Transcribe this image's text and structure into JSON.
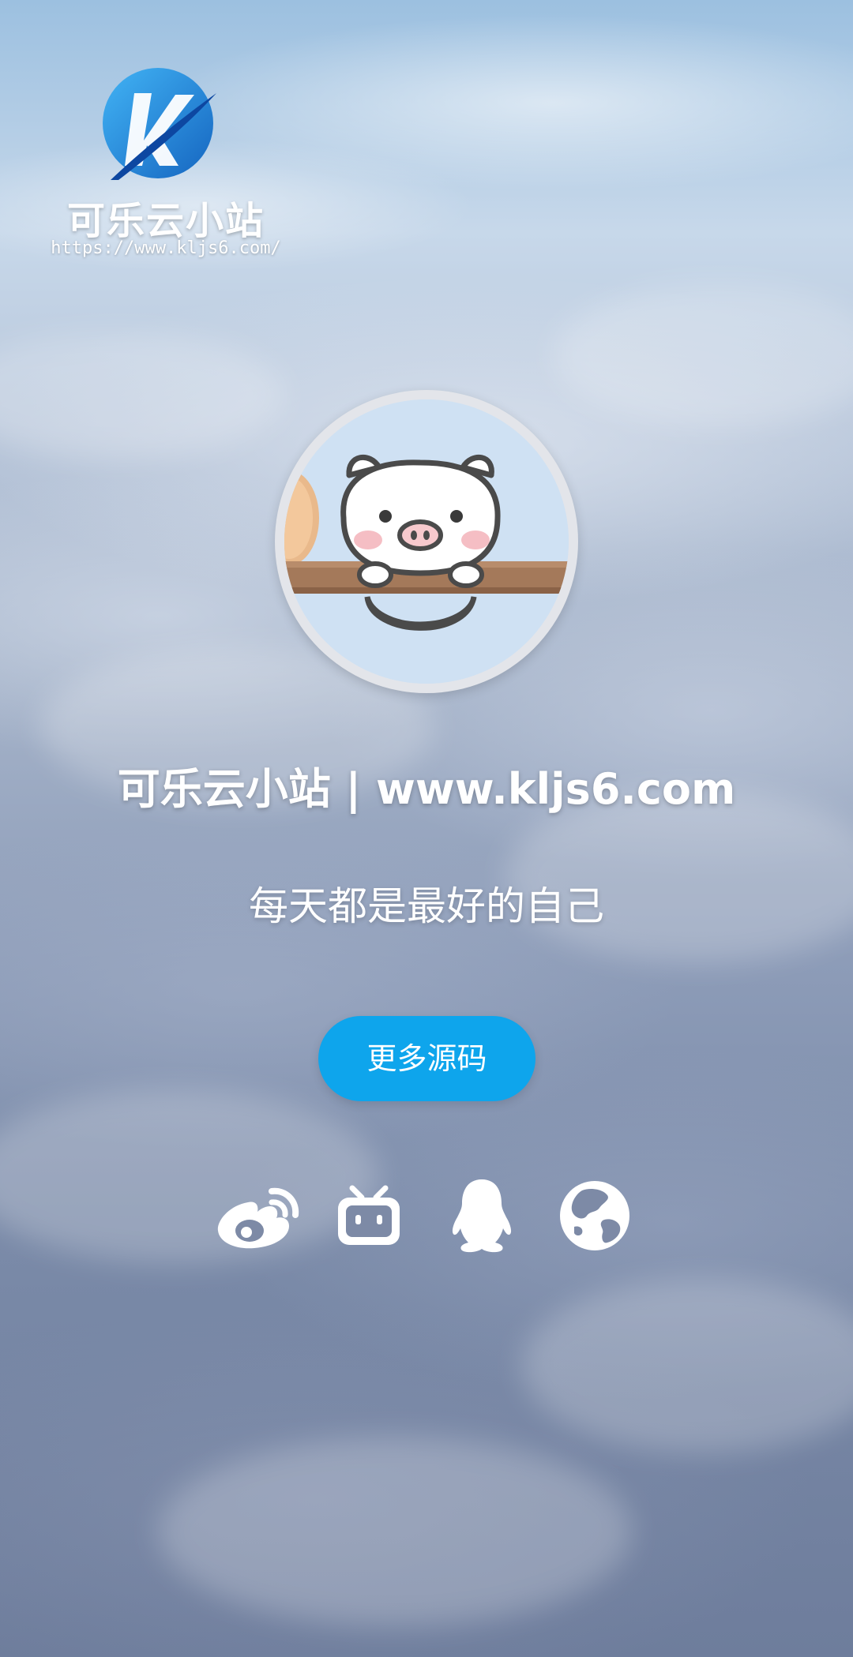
{
  "brand": {
    "logo_letter": "K",
    "title": "可乐云小站",
    "url": "https://www.kljs6.com/"
  },
  "profile": {
    "site_title": "可乐云小站 | www.kljs6.com",
    "motto": "每天都是最好的自己"
  },
  "actions": {
    "more_button_label": "更多源码"
  },
  "social": [
    {
      "icon": "weibo-icon"
    },
    {
      "icon": "bilibili-icon"
    },
    {
      "icon": "qq-icon"
    },
    {
      "icon": "globe-icon"
    }
  ],
  "colors": {
    "accent": "#0ea5ec",
    "logo_blue": "#1e88e5",
    "text": "#ffffff"
  }
}
